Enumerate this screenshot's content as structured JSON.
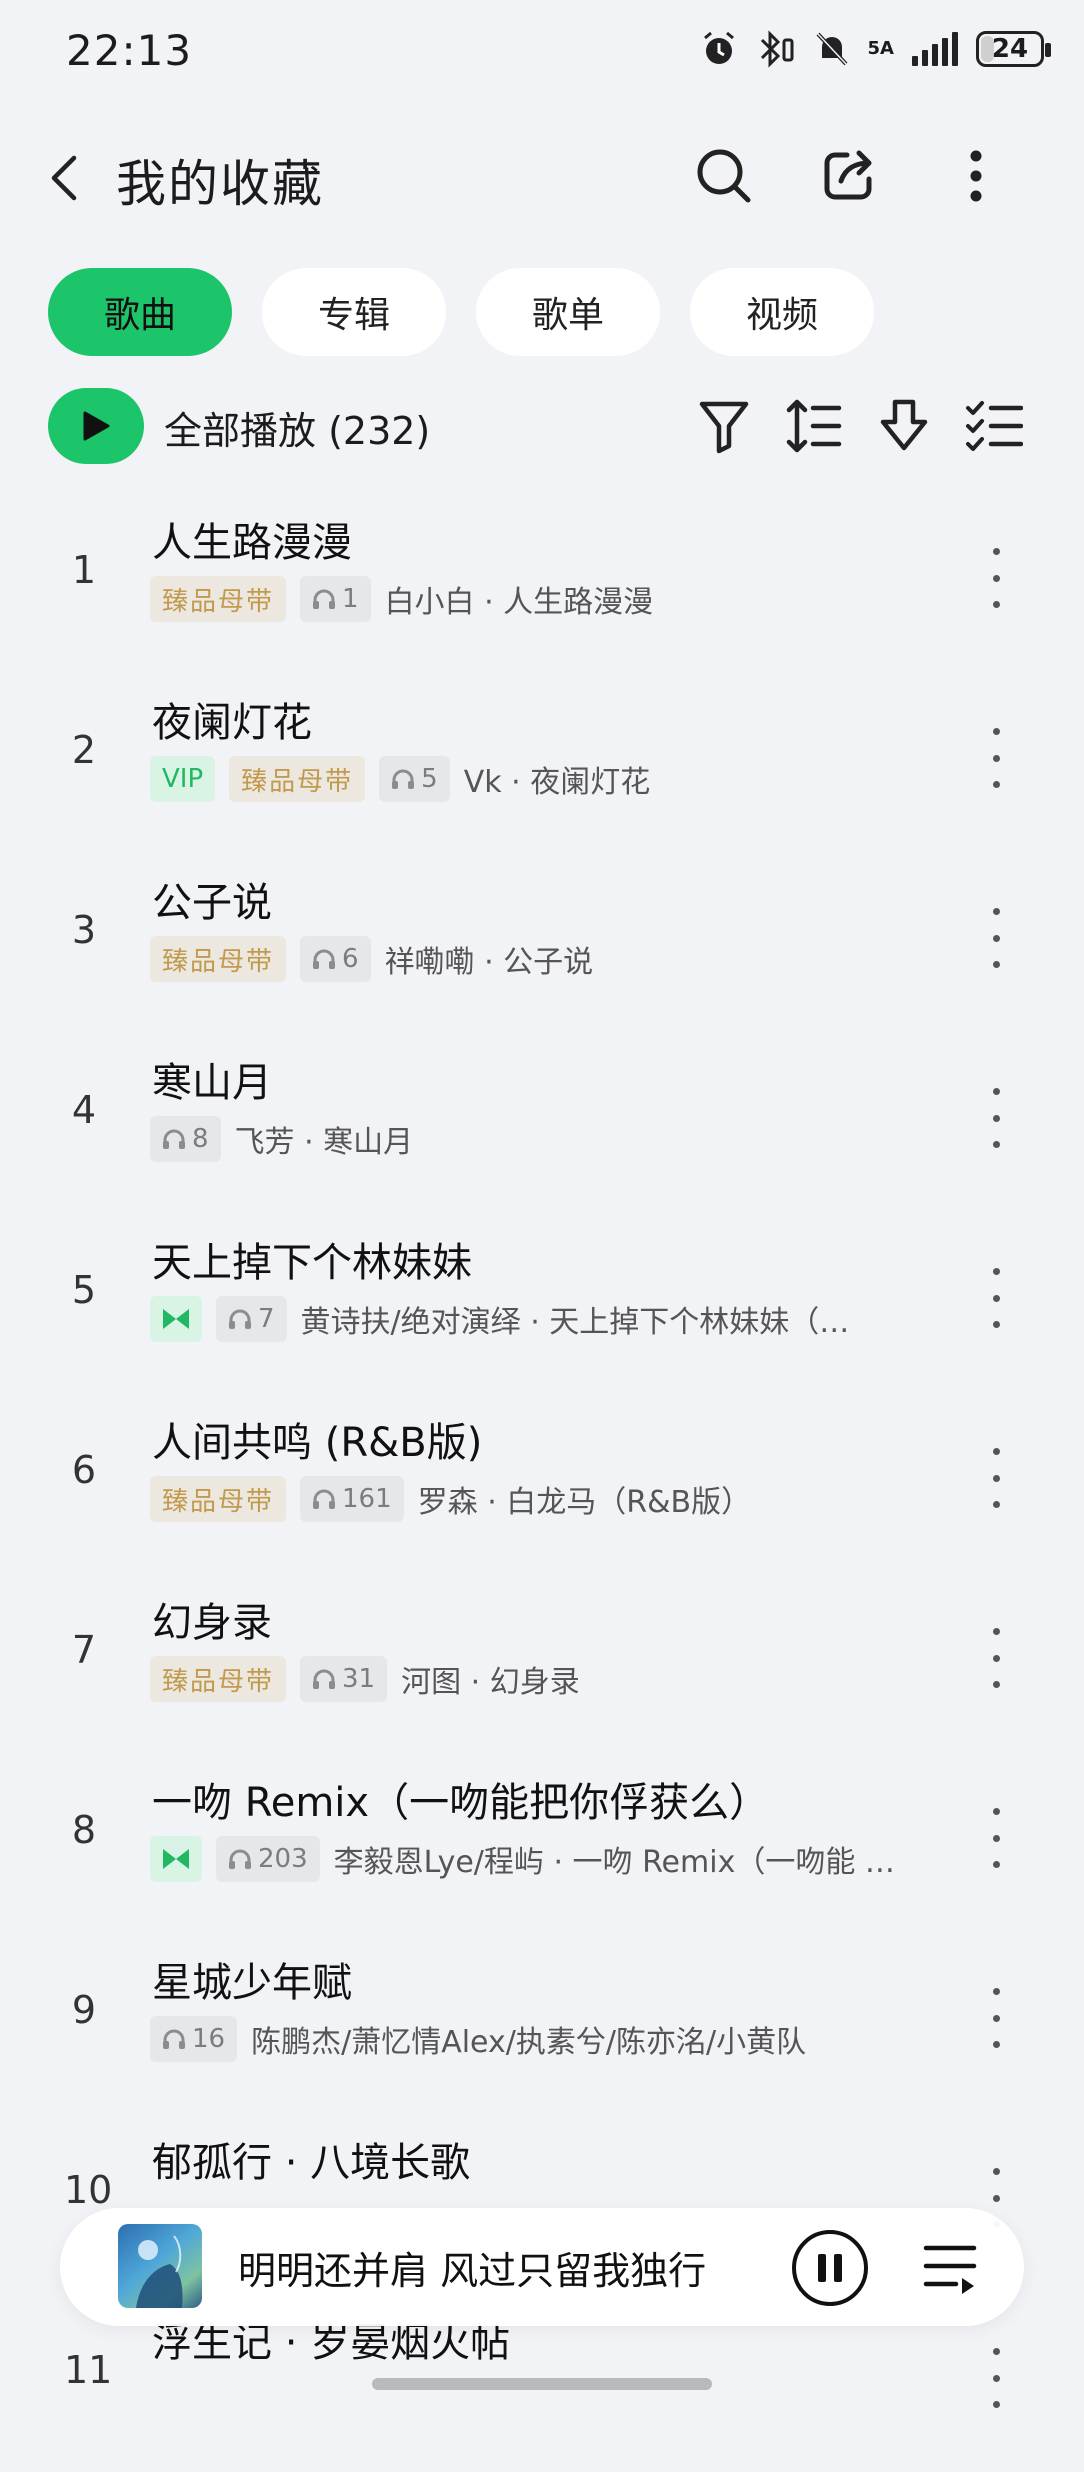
{
  "status_bar": {
    "time": "22:13",
    "network": "5A",
    "battery": "24",
    "battery_level_percent": 24
  },
  "header": {
    "title": "我的收藏",
    "back_icon": "chevron-left-icon",
    "search_icon": "search-icon",
    "share_icon": "share-icon",
    "more_icon": "more-vertical-icon"
  },
  "tabs": [
    {
      "label": "歌曲",
      "active": true
    },
    {
      "label": "专辑",
      "active": false
    },
    {
      "label": "歌单",
      "active": false
    },
    {
      "label": "视频",
      "active": false
    }
  ],
  "playall": {
    "label": "全部播放 (232)"
  },
  "toolbar": {
    "filter_icon": "filter-icon",
    "sort_icon": "sort-icon",
    "download_icon": "download-icon",
    "multiselect_icon": "multi-select-icon"
  },
  "songs": [
    {
      "index": "1",
      "title": "人生路漫漫",
      "badges": [
        "臻品母带"
      ],
      "plays": "1",
      "artist": "白小白 · 人生路漫漫"
    },
    {
      "index": "2",
      "title": "夜阑灯花",
      "badges": [
        "VIP",
        "臻品母带"
      ],
      "plays": "5",
      "artist": "Vk · 夜阑灯花"
    },
    {
      "index": "3",
      "title": "公子说",
      "badges": [
        "臻品母带"
      ],
      "plays": "6",
      "artist": "祥嘞嘞 · 公子说"
    },
    {
      "index": "4",
      "title": "寒山月",
      "badges": [],
      "plays": "8",
      "artist": "飞芳 · 寒山月"
    },
    {
      "index": "5",
      "title": "天上掉下个林妹妹",
      "badges": [
        "MV"
      ],
      "plays": "7",
      "artist": "黄诗扶/绝对演绎 · 天上掉下个林妹妹（…"
    },
    {
      "index": "6",
      "title": "人间共鸣 (R&B版)",
      "badges": [
        "臻品母带"
      ],
      "plays": "161",
      "artist": "罗森 · 白龙马（R&B版）"
    },
    {
      "index": "7",
      "title": "幻身录",
      "badges": [
        "臻品母带"
      ],
      "plays": "31",
      "artist": "河图 · 幻身录"
    },
    {
      "index": "8",
      "title": "一吻 Remix（一吻能把你俘获么）",
      "badges": [
        "MV"
      ],
      "plays": "203",
      "artist": "李毅恩Lye/程屿 · 一吻 Remix（一吻能 …"
    },
    {
      "index": "9",
      "title": "星城少年赋",
      "badges": [],
      "plays": "16",
      "artist": "陈鹏杰/萧忆情Alex/执素兮/陈亦洺/小黄队 …"
    },
    {
      "index": "10",
      "title": "郁孤行 · 八境长歌",
      "badges": [],
      "plays": "",
      "artist": ""
    },
    {
      "index": "11",
      "title": "浮生记 · 岁晏烟火帖",
      "badges": [],
      "plays": "",
      "artist": ""
    }
  ],
  "player": {
    "now_playing": "明明还并肩 风过只留我独行",
    "pause_icon": "pause-icon",
    "queue_icon": "playlist-icon"
  },
  "colors": {
    "accent": "#1cc46a",
    "background": "#f2f3f6",
    "gold_badge_text": "#c29a4e",
    "gold_badge_bg": "#ece8e0"
  }
}
